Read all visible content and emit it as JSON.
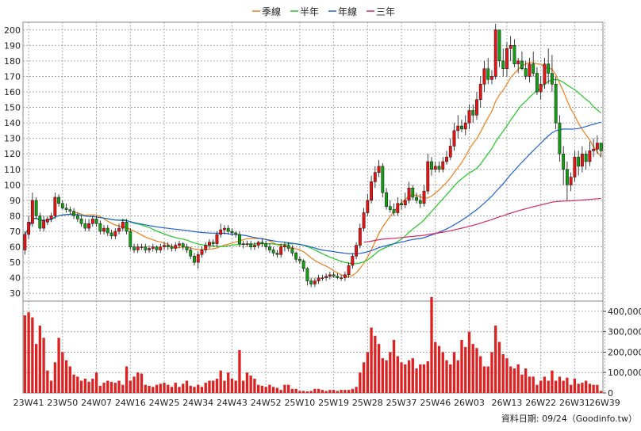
{
  "chart_data": {
    "type": "candlestick",
    "legend": [
      {
        "name": "季線",
        "color": "#f07d1a"
      },
      {
        "name": "半年",
        "color": "#22c722"
      },
      {
        "name": "年線",
        "color": "#1f5fd6"
      },
      {
        "name": "三年",
        "color": "#d62a63"
      }
    ],
    "legend_position": "top-center",
    "grid": true,
    "up_color": "#ee1111",
    "down_color": "#10a010",
    "volume_color": "#dd2222",
    "price_axis": {
      "ylim": [
        25,
        205
      ],
      "ticks": [
        30,
        40,
        50,
        60,
        70,
        80,
        90,
        100,
        110,
        120,
        130,
        140,
        150,
        160,
        170,
        180,
        190,
        200
      ]
    },
    "volume_axis": {
      "ylim": [
        0,
        450000
      ],
      "ticks": [
        0,
        100000,
        200000,
        300000,
        400000
      ],
      "tick_labels": [
        "0",
        "100,000",
        "200,000",
        "300,000",
        "400,000"
      ]
    },
    "x_tick_labels": [
      "23W41",
      "23W50",
      "24W07",
      "24W16",
      "24W25",
      "24W34",
      "24W43",
      "24W52",
      "25W10",
      "25W19",
      "25W28",
      "25W37",
      "25W46",
      "26W03",
      "26W13",
      "26W22",
      "26W31",
      "26W39"
    ],
    "x_tick_index": [
      1,
      10,
      19,
      28,
      37,
      46,
      55,
      64,
      73,
      82,
      91,
      100,
      109,
      118,
      128,
      137,
      146,
      154
    ],
    "footer": "資料日期: 09/24（Goodinfo.tw）",
    "weeks": {
      "o": [
        58,
        68,
        75,
        90,
        80,
        72,
        76,
        78,
        80,
        92,
        88,
        85,
        84,
        83,
        80,
        78,
        75,
        72,
        75,
        78,
        75,
        70,
        72,
        69,
        67,
        70,
        72,
        76,
        70,
        60,
        58,
        60,
        60,
        58,
        59,
        60,
        58,
        60,
        61,
        60,
        59,
        61,
        62,
        60,
        58,
        54,
        50,
        55,
        58,
        61,
        63,
        62,
        68,
        71,
        72,
        70,
        69,
        68,
        62,
        62,
        62,
        60,
        61,
        63,
        62,
        60,
        58,
        56,
        55,
        60,
        61,
        59,
        56,
        52,
        51,
        46,
        38,
        36,
        38,
        40,
        40,
        41,
        42,
        41,
        40,
        40,
        42,
        48,
        54,
        61,
        72,
        82,
        90,
        102,
        108,
        112,
        95,
        86,
        84,
        82,
        88,
        87,
        90,
        98,
        92,
        90,
        88,
        96,
        115,
        110,
        112,
        110,
        115,
        118,
        125,
        135,
        138,
        136,
        140,
        148,
        145,
        155,
        165,
        175,
        168,
        170,
        200,
        180,
        175,
        188,
        190,
        178,
        180,
        175,
        170,
        178,
        172,
        160,
        165,
        178,
        172,
        165,
        140,
        120,
        110,
        100,
        105,
        118,
        112,
        120,
        115,
        122,
        123,
        127
      ],
      "c": [
        68,
        76,
        90,
        80,
        72,
        77,
        78,
        80,
        92,
        88,
        85,
        84,
        83,
        80,
        78,
        75,
        72,
        75,
        78,
        75,
        70,
        72,
        69,
        67,
        70,
        72,
        76,
        70,
        60,
        58,
        60,
        60,
        58,
        59,
        60,
        58,
        60,
        61,
        60,
        59,
        61,
        62,
        60,
        58,
        54,
        50,
        55,
        58,
        61,
        63,
        62,
        68,
        71,
        72,
        70,
        69,
        68,
        62,
        62,
        62,
        60,
        61,
        63,
        62,
        60,
        58,
        56,
        55,
        60,
        61,
        59,
        56,
        52,
        51,
        46,
        38,
        36,
        38,
        40,
        40,
        41,
        42,
        41,
        40,
        40,
        42,
        48,
        54,
        61,
        72,
        82,
        90,
        102,
        108,
        112,
        95,
        86,
        84,
        82,
        88,
        87,
        90,
        98,
        92,
        90,
        88,
        96,
        115,
        110,
        112,
        110,
        115,
        118,
        125,
        135,
        138,
        136,
        140,
        148,
        145,
        155,
        165,
        175,
        168,
        170,
        200,
        180,
        175,
        188,
        190,
        178,
        180,
        175,
        170,
        178,
        172,
        160,
        165,
        178,
        172,
        165,
        140,
        120,
        110,
        100,
        105,
        118,
        112,
        120,
        115,
        122,
        123,
        127,
        122
      ],
      "h": [
        70,
        80,
        95,
        92,
        82,
        80,
        80,
        82,
        95,
        94,
        90,
        88,
        86,
        85,
        82,
        80,
        78,
        78,
        80,
        80,
        77,
        74,
        74,
        71,
        72,
        75,
        78,
        78,
        72,
        62,
        62,
        62,
        62,
        61,
        62,
        61,
        62,
        63,
        63,
        62,
        63,
        64,
        63,
        62,
        60,
        56,
        57,
        60,
        63,
        65,
        65,
        70,
        75,
        74,
        74,
        72,
        70,
        70,
        64,
        64,
        64,
        63,
        64,
        65,
        64,
        62,
        60,
        58,
        62,
        63,
        63,
        61,
        57,
        54,
        52,
        47,
        40,
        40,
        42,
        42,
        43,
        44,
        44,
        43,
        42,
        44,
        50,
        56,
        63,
        75,
        85,
        94,
        106,
        112,
        116,
        114,
        98,
        90,
        88,
        92,
        91,
        95,
        102,
        100,
        95,
        94,
        100,
        120,
        118,
        115,
        115,
        118,
        122,
        130,
        140,
        145,
        142,
        145,
        152,
        152,
        160,
        170,
        180,
        182,
        174,
        204,
        200,
        188,
        192,
        196,
        194,
        182,
        186,
        180,
        182,
        186,
        176,
        170,
        182,
        188,
        184,
        170,
        145,
        125,
        115,
        108,
        122,
        122,
        125,
        122,
        128,
        130,
        132,
        127
      ],
      "l": [
        55,
        65,
        73,
        78,
        70,
        70,
        74,
        76,
        78,
        86,
        84,
        82,
        81,
        78,
        76,
        73,
        70,
        70,
        73,
        73,
        68,
        68,
        67,
        65,
        65,
        68,
        70,
        68,
        58,
        56,
        56,
        58,
        56,
        56,
        57,
        56,
        56,
        58,
        58,
        57,
        57,
        59,
        58,
        56,
        52,
        48,
        46,
        53,
        56,
        59,
        60,
        60,
        66,
        68,
        68,
        67,
        66,
        60,
        59,
        60,
        58,
        58,
        59,
        60,
        58,
        56,
        54,
        53,
        53,
        57,
        57,
        54,
        50,
        49,
        44,
        35,
        34,
        34,
        36,
        38,
        38,
        39,
        40,
        39,
        38,
        38,
        40,
        46,
        52,
        59,
        70,
        80,
        88,
        98,
        105,
        92,
        84,
        82,
        80,
        80,
        84,
        85,
        88,
        90,
        88,
        85,
        86,
        94,
        106,
        108,
        108,
        108,
        113,
        116,
        122,
        130,
        134,
        132,
        136,
        140,
        142,
        150,
        160,
        165,
        165,
        168,
        176,
        170,
        170,
        180,
        176,
        172,
        174,
        168,
        166,
        170,
        158,
        155,
        162,
        165,
        160,
        136,
        115,
        100,
        90,
        96,
        102,
        106,
        108,
        110,
        112,
        118,
        120,
        118
      ],
      "vol": [
        380000,
        395000,
        370000,
        240000,
        330000,
        270000,
        110000,
        60000,
        150000,
        270000,
        200000,
        160000,
        130000,
        90000,
        80000,
        60000,
        70000,
        55000,
        70000,
        100000,
        35000,
        50000,
        60000,
        55000,
        50000,
        60000,
        40000,
        130000,
        60000,
        80000,
        100000,
        95000,
        40000,
        35000,
        30000,
        40000,
        45000,
        50000,
        40000,
        30000,
        50000,
        30000,
        45000,
        60000,
        35000,
        30000,
        40000,
        30000,
        50000,
        60000,
        60000,
        70000,
        110000,
        60000,
        100000,
        70000,
        60000,
        210000,
        60000,
        100000,
        85000,
        70000,
        40000,
        35000,
        30000,
        40000,
        30000,
        25000,
        15000,
        40000,
        40000,
        20000,
        20000,
        10000,
        10000,
        8000,
        10000,
        20000,
        20000,
        15000,
        10000,
        15000,
        15000,
        10000,
        15000,
        15000,
        15000,
        20000,
        30000,
        100000,
        150000,
        200000,
        320000,
        280000,
        240000,
        170000,
        160000,
        200000,
        260000,
        180000,
        150000,
        140000,
        160000,
        170000,
        120000,
        140000,
        140000,
        155000,
        470000,
        250000,
        230000,
        200000,
        160000,
        140000,
        200000,
        160000,
        260000,
        225000,
        300000,
        240000,
        220000,
        180000,
        130000,
        130000,
        200000,
        330000,
        250000,
        190000,
        170000,
        130000,
        120000,
        140000,
        90000,
        120000,
        80000,
        80000,
        40000,
        60000,
        80000,
        60000,
        110000,
        60000,
        80000,
        60000,
        75000,
        40000,
        70000,
        45000,
        50000,
        60000,
        45000,
        40000,
        40000,
        10000
      ]
    }
  }
}
